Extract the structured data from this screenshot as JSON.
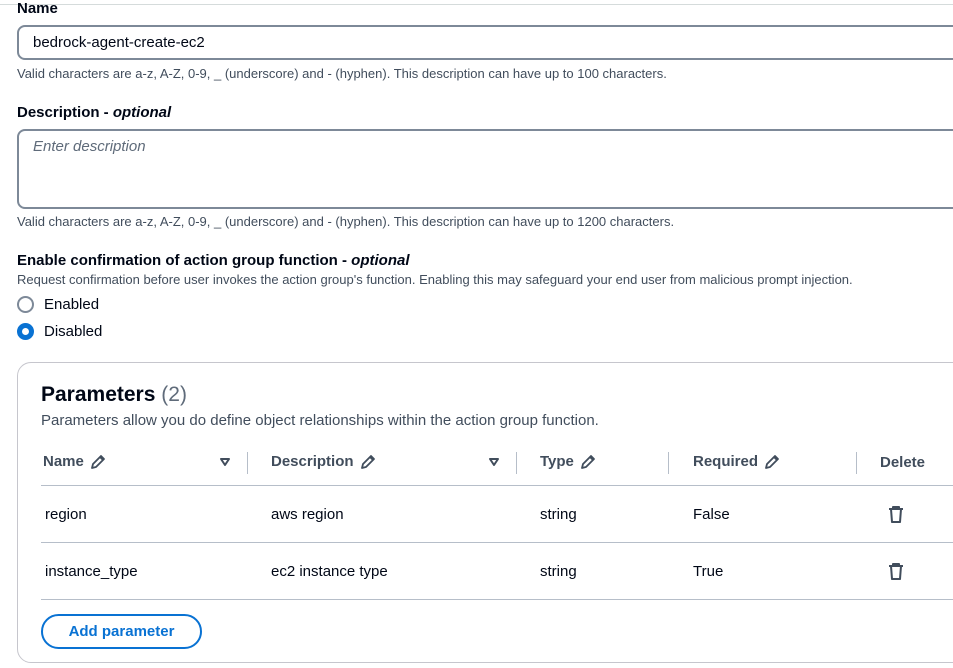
{
  "name_field": {
    "label": "Name",
    "value": "bedrock-agent-create-ec2",
    "hint": "Valid characters are a-z, A-Z, 0-9, _ (underscore) and - (hyphen). This description can have up to 100 characters."
  },
  "description_field": {
    "label": "Description",
    "optional": "optional",
    "placeholder": "Enter description",
    "hint": "Valid characters are a-z, A-Z, 0-9, _ (underscore) and - (hyphen). This description can have up to 1200 characters."
  },
  "confirmation": {
    "label": "Enable confirmation of action group function",
    "optional": "optional",
    "description": "Request confirmation before user invokes the action group's function. Enabling this may safeguard your end user from malicious prompt injection.",
    "options": [
      {
        "label": "Enabled",
        "selected": false
      },
      {
        "label": "Disabled",
        "selected": true
      }
    ]
  },
  "parameters": {
    "title": "Parameters",
    "count": "(2)",
    "description": "Parameters allow you do define object relationships within the action group function.",
    "columns": {
      "name": "Name",
      "description": "Description",
      "type": "Type",
      "required": "Required",
      "delete": "Delete"
    },
    "rows": [
      {
        "name": "region",
        "description": "aws region",
        "type": "string",
        "required": "False"
      },
      {
        "name": "instance_type",
        "description": "ec2 instance type",
        "type": "string",
        "required": "True"
      }
    ],
    "add_button": "Add parameter"
  },
  "colors": {
    "accent": "#0972d3",
    "text": "#000716",
    "muted": "#414d5c",
    "border": "#7d8998"
  },
  "icons": [
    "pencil-icon",
    "sort-caret-icon",
    "trash-icon",
    "radio-icon"
  ]
}
